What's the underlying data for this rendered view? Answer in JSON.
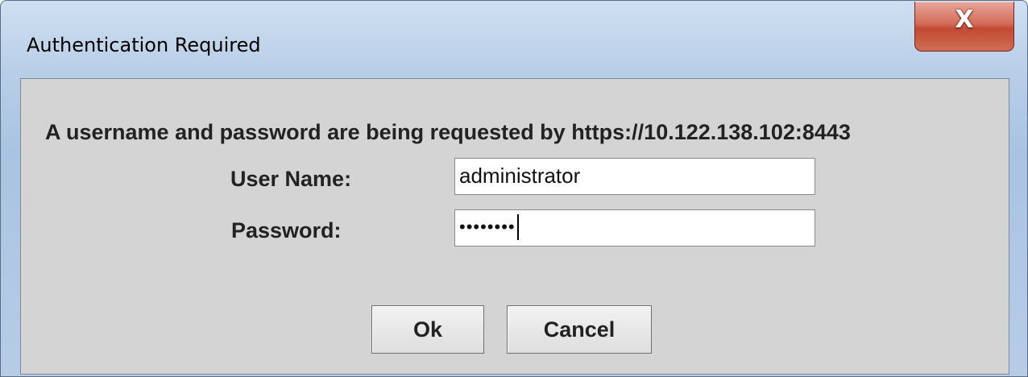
{
  "window": {
    "title": "Authentication Required",
    "close_glyph": "X",
    "close_icon": "close-icon"
  },
  "message": "A username and password are being requested by https://10.122.138.102:8443",
  "form": {
    "username_label": "User Name:",
    "username_value": "administrator",
    "password_label": "Password:",
    "password_masked": "••••••••"
  },
  "buttons": {
    "ok_label": "Ok",
    "cancel_label": "Cancel"
  },
  "colors": {
    "titlebar": "#b9cfe8",
    "close_button": "#c24a34",
    "dialog_body": "#d4d4d4"
  }
}
